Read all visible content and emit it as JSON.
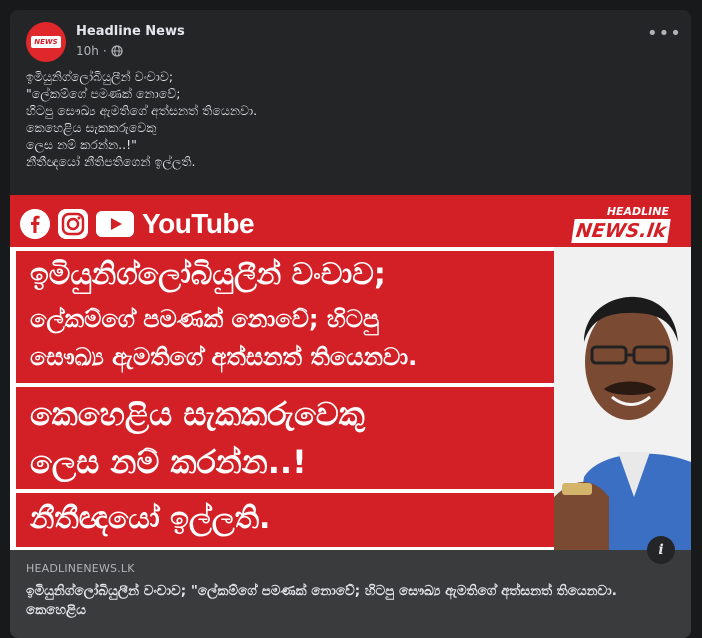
{
  "post": {
    "page_name": "Headline News",
    "time": "10h",
    "caption_lines": [
      "ඉමියුනිග්ලෝබියුලීන් වංචාව;",
      "\"ලේකම්ගේ පමණක් නොවේ;",
      "හිටපු සෞඛ්‍ය ඇමතිගේ අත්සනත් තියෙනවා.",
      "කෙහෙළිය සැකකරුවෙකු",
      "ලෙස නම් කරන්න..!\"",
      "නීතීඥයෝ නීතිපතිගෙන් ඉල්ලති."
    ]
  },
  "image": {
    "youtube_label": "YouTube",
    "brand_logo_text": "NEWS.lk",
    "brand_top_text": "HEADLINE",
    "headline_lines": [
      "ඉමියුනිග්ලෝබියුලීන් වංචාව;",
      "ලේකම්ගේ පමණක් නොවේ; හිටපු",
      "සෞඛ්‍ය ඇමතිගේ අත්සනත් තියෙනවා.",
      "කෙහෙළිය සැකකරුවෙකු",
      "ලෙස නම් කරන්න..!",
      "නීතීඥයෝ ඉල්ලති."
    ]
  },
  "link": {
    "domain": "HEADLINENEWS.LK",
    "title": "ඉමියුනිග්ලෝබියුලීන් වංචාව; \"ලේකම්ගේ පමණක් නොවේ; හිටපු සෞඛ්‍ය ඇමතිගේ අත්සනත් තියෙනවා. කෙහෙළිය"
  },
  "colors": {
    "card_bg": "#242526",
    "accent_red": "#d31f26",
    "text_primary": "#e4e6eb",
    "text_secondary": "#b0b3b8"
  },
  "icons": {
    "globe": "globe-icon",
    "more": "more-horizontal-icon",
    "info": "info-icon"
  }
}
